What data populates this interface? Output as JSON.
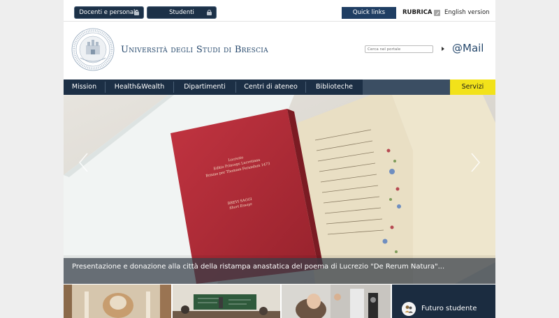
{
  "topbar": {
    "login_docenti": "Docenti e personale",
    "login_studenti": "Studenti",
    "quick_links": "Quick links",
    "rubrica": "RUBRICA",
    "english": "English version"
  },
  "header": {
    "university_name": "Università degli Studi di Brescia",
    "search_placeholder": "Cerca nel portale",
    "mail": "@Mail"
  },
  "nav": {
    "items": [
      {
        "label": "Mission"
      },
      {
        "label": "Health&Wealth"
      },
      {
        "label": "Dipartimenti"
      },
      {
        "label": "Centri di ateneo"
      },
      {
        "label": "Biblioteche"
      }
    ],
    "servizi": "Servizi"
  },
  "slide": {
    "caption": "Presentazione e donazione alla città della ristampa anastatica del poema di Lucrezio \"De Rerum Natura\"...",
    "book_title_lines": [
      "Lucrezio",
      "Editio Princeps Lucretiana",
      "Brixiae per Thomam Ferandum 1473"
    ],
    "book_footer_lines": [
      "BREVI SAGGI",
      "Short Essays"
    ]
  },
  "side_panel": {
    "futuro_studente": "Futuro studente"
  },
  "colors": {
    "brand_blue": "#24476b",
    "nav_dark": "#1c2f45",
    "servizi_yellow": "#f2e21a",
    "book_red": "#b52b35"
  },
  "icons": [
    "lock-icon",
    "rubrica-icon",
    "search-go-icon",
    "prev-arrow-icon",
    "next-arrow-icon",
    "user-group-icon"
  ]
}
